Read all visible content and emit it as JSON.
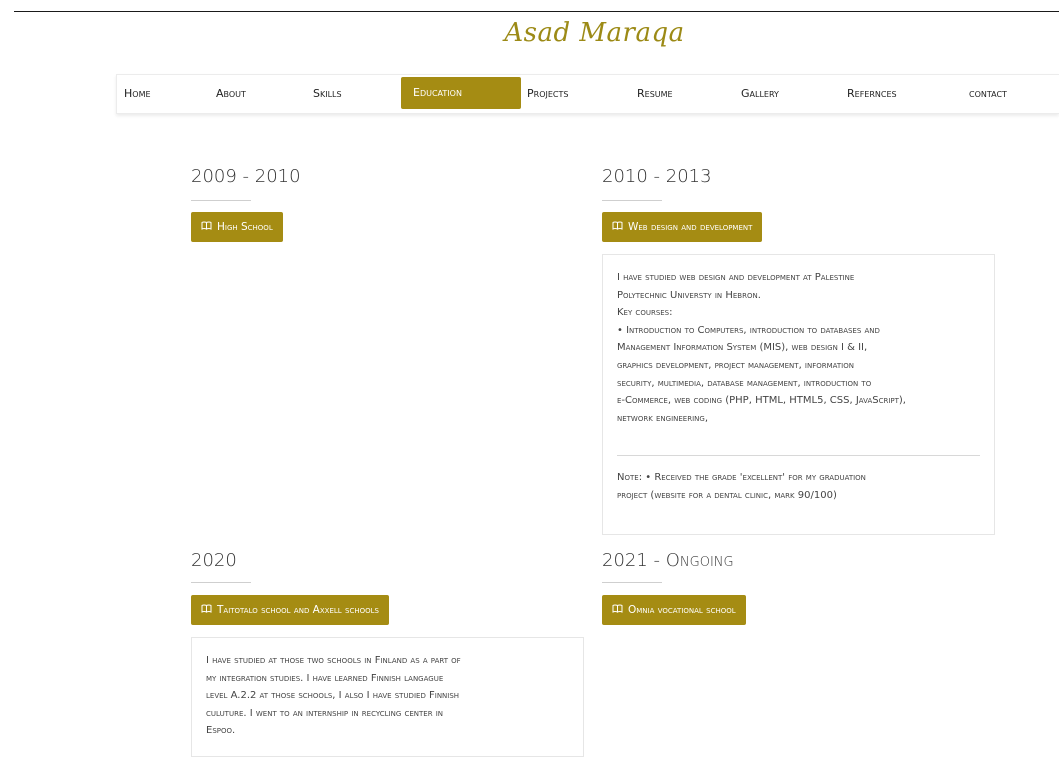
{
  "brand": {
    "name": "Asad Maraqa"
  },
  "nav": {
    "items": [
      {
        "label": "Home"
      },
      {
        "label": "About"
      },
      {
        "label": "Skills"
      },
      {
        "label": "Education"
      },
      {
        "label": "Projects"
      },
      {
        "label": "Resume"
      },
      {
        "label": "Gallery"
      },
      {
        "label": "Refernces"
      },
      {
        "label": "contact"
      }
    ],
    "active": "Education"
  },
  "education": [
    {
      "years": "2009 - 2010",
      "title": "High School",
      "icon": "book-icon"
    },
    {
      "years": "2010 - 2013",
      "title": "Web design and development",
      "icon": "book-icon",
      "description": [
        "I have studied web design and development at Palestine",
        "Polytechnic Universty in Hebron.",
        "Key courses:",
        "• Introduction to Computers, introduction to databases and",
        "Management Information System (MIS), web design I & II,",
        "graphics development, project management, information",
        "security, multimedia, database management, introduction to",
        "e-Commerce, web coding (PHP, HTML, HTML5, CSS, JavaScript),",
        "network engineering,"
      ],
      "note": [
        "Note: • Received the grade 'excellent' for my graduation",
        "project (website for a dental clinic, mark 90/100)"
      ]
    },
    {
      "years": "2020",
      "title": "Taitotalo school and Axxell schools",
      "icon": "book-icon",
      "description": [
        "I have studied at those two schools in Finland as a part of",
        "my integration studies. I have learned Finnish langague",
        "level A.2.2 at those schools, I also I have studied Finnish",
        "culuture. I went to an internship in recycling center in",
        "Espoo."
      ]
    },
    {
      "years": "2021 - Ongoing",
      "title": "Omnia vocational school",
      "icon": "book-icon"
    }
  ],
  "colors": {
    "accent": "#a58c13",
    "brand": "#9c8a16"
  }
}
